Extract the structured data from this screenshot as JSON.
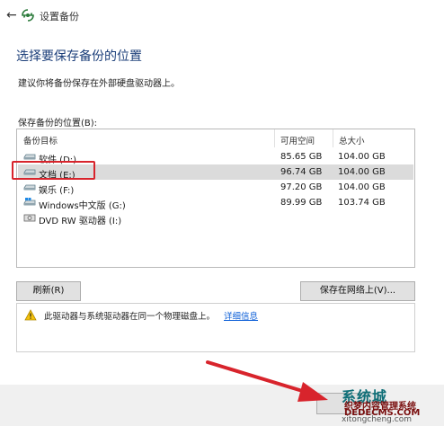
{
  "window": {
    "back_glyph": "←",
    "title": "设置备份"
  },
  "heading": "选择要保存备份的位置",
  "subtitle": "建议你将备份保存在外部硬盘驱动器上。",
  "list_label": "保存备份的位置(B):",
  "columns": [
    "备份目标",
    "可用空间",
    "总大小"
  ],
  "drives": [
    {
      "name": "软件 (D:)",
      "free": "85.65 GB",
      "total": "104.00 GB",
      "icon": "drive-icon",
      "selected": false
    },
    {
      "name": "文档 (E:)",
      "free": "96.74 GB",
      "total": "104.00 GB",
      "icon": "drive-icon",
      "selected": true
    },
    {
      "name": "娱乐 (F:)",
      "free": "97.20 GB",
      "total": "104.00 GB",
      "icon": "drive-icon",
      "selected": false
    },
    {
      "name": "Windows中文版 (G:)",
      "free": "89.99 GB",
      "total": "103.74 GB",
      "icon": "windows-drive-icon",
      "selected": false
    },
    {
      "name": "DVD RW 驱动器 (I:)",
      "free": "",
      "total": "",
      "icon": "dvd-drive-icon",
      "selected": false
    }
  ],
  "buttons": {
    "refresh": "刷新(R)",
    "save_network": "保存在网络上(V)..."
  },
  "warning": {
    "text": "此驱动器与系统驱动器在同一个物理磁盘上。",
    "link": "详细信息"
  },
  "watermark": {
    "cn": "系统城",
    "sub": "织梦内容管理系统",
    "en": "DEDECMS.COM",
    "url": "xitongcheng.com"
  },
  "colors": {
    "accent_heading": "#1c3f7a",
    "highlight": "#d8242c",
    "selection": "#dbdbdb",
    "link": "#0b5ed7"
  }
}
